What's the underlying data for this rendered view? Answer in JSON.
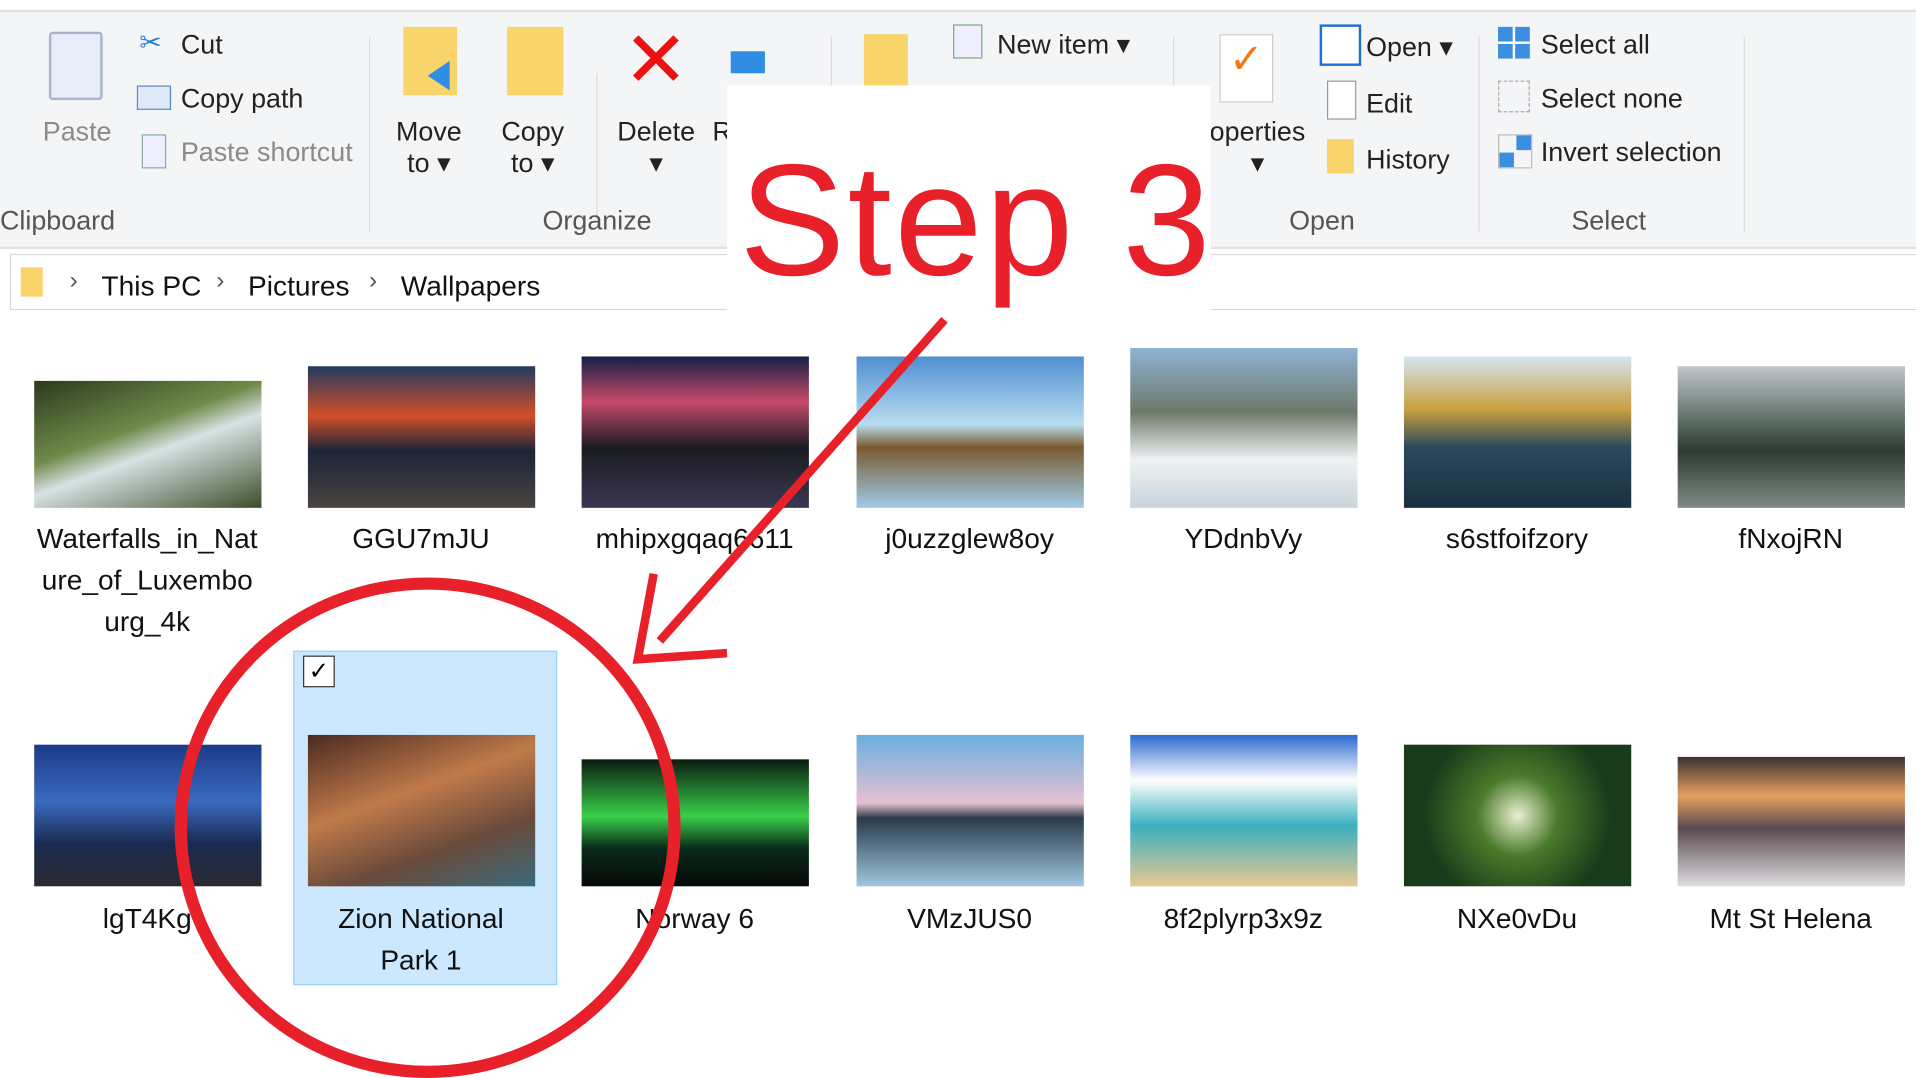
{
  "ribbon": {
    "clipboard": {
      "group": "Clipboard",
      "paste": "Paste",
      "cut": "Cut",
      "copy_path": "Copy path",
      "paste_shortcut": "Paste shortcut"
    },
    "organize": {
      "group": "Organize",
      "move": "Move",
      "move_to": "to",
      "copy": "Copy",
      "copy_to": "to",
      "delete": "Delete",
      "rename_partial": "R"
    },
    "new": {
      "new_item": "New item"
    },
    "open": {
      "group": "Open",
      "properties_partial": "operties",
      "open": "Open",
      "edit": "Edit",
      "history": "History"
    },
    "select": {
      "group": "Select",
      "select_all": "Select all",
      "select_none": "Select none",
      "invert": "Invert selection"
    }
  },
  "address": {
    "crumbs": [
      "This PC",
      "Pictures",
      "Wallpapers"
    ]
  },
  "annotation": {
    "text": "Step 3",
    "color": "#e8202a"
  },
  "files": [
    {
      "name": "Waterfalls_in_Nature_of_Luxembourg_4k",
      "lines": [
        "Waterfalls_in_Nat",
        "ure_of_Luxembo",
        "urg_4k"
      ]
    },
    {
      "name": "GGU7mJU"
    },
    {
      "name": "mhipxgqaq6611"
    },
    {
      "name": "j0uzzglew8oy"
    },
    {
      "name": "YDdnbVy"
    },
    {
      "name": "s6stfoifzory"
    },
    {
      "name": "fNxojRN"
    },
    {
      "name": "lgT4Kg"
    },
    {
      "name": "Zion National Park 1",
      "lines": [
        "Zion National",
        "Park 1"
      ],
      "selected": true
    },
    {
      "name": "Norway 6"
    },
    {
      "name": "VMzJUS0"
    },
    {
      "name": "8f2plyrp3x9z"
    },
    {
      "name": "NXe0vDu"
    },
    {
      "name": "Mt St Helena"
    }
  ]
}
